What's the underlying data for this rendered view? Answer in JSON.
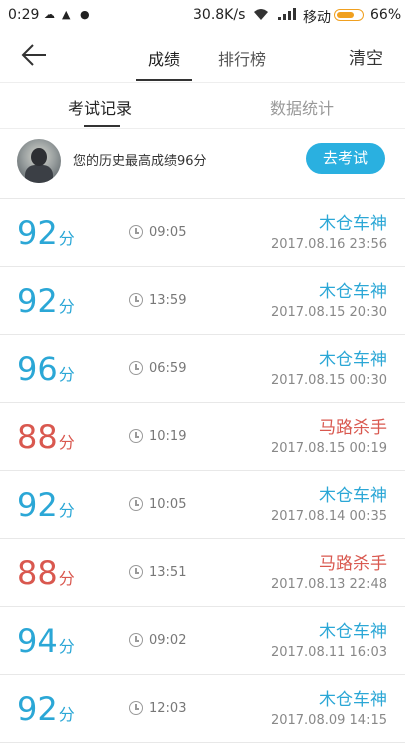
{
  "status_bar": {
    "time": "0:29",
    "net_speed": "30.8K/s",
    "carrier": "移动",
    "battery": "66%"
  },
  "nav": {
    "tabs": [
      "成绩",
      "排行榜"
    ],
    "active_tab": 0,
    "clear_label": "清空"
  },
  "subtabs": {
    "items": [
      "考试记录",
      "数据统计"
    ],
    "active": 0
  },
  "best": {
    "text": "您的历史最高成绩96分",
    "button_label": "去考试"
  },
  "records": [
    {
      "score": "92",
      "unit": "分",
      "duration": "09:05",
      "title": "木仓车神",
      "date": "2017.08.16  23:56",
      "color": "#2ba7d6"
    },
    {
      "score": "92",
      "unit": "分",
      "duration": "13:59",
      "title": "木仓车神",
      "date": "2017.08.15  20:30",
      "color": "#2ba7d6"
    },
    {
      "score": "96",
      "unit": "分",
      "duration": "06:59",
      "title": "木仓车神",
      "date": "2017.08.15  00:30",
      "color": "#2ba7d6"
    },
    {
      "score": "88",
      "unit": "分",
      "duration": "10:19",
      "title": "马路杀手",
      "date": "2017.08.15  00:19",
      "color": "#d9584f"
    },
    {
      "score": "92",
      "unit": "分",
      "duration": "10:05",
      "title": "木仓车神",
      "date": "2017.08.14  00:35",
      "color": "#2ba7d6"
    },
    {
      "score": "88",
      "unit": "分",
      "duration": "13:51",
      "title": "马路杀手",
      "date": "2017.08.13  22:48",
      "color": "#d9584f"
    },
    {
      "score": "94",
      "unit": "分",
      "duration": "09:02",
      "title": "木仓车神",
      "date": "2017.08.11  16:03",
      "color": "#2ba7d6"
    },
    {
      "score": "92",
      "unit": "分",
      "duration": "12:03",
      "title": "木仓车神",
      "date": "2017.08.09  14:15",
      "color": "#2ba7d6"
    }
  ]
}
